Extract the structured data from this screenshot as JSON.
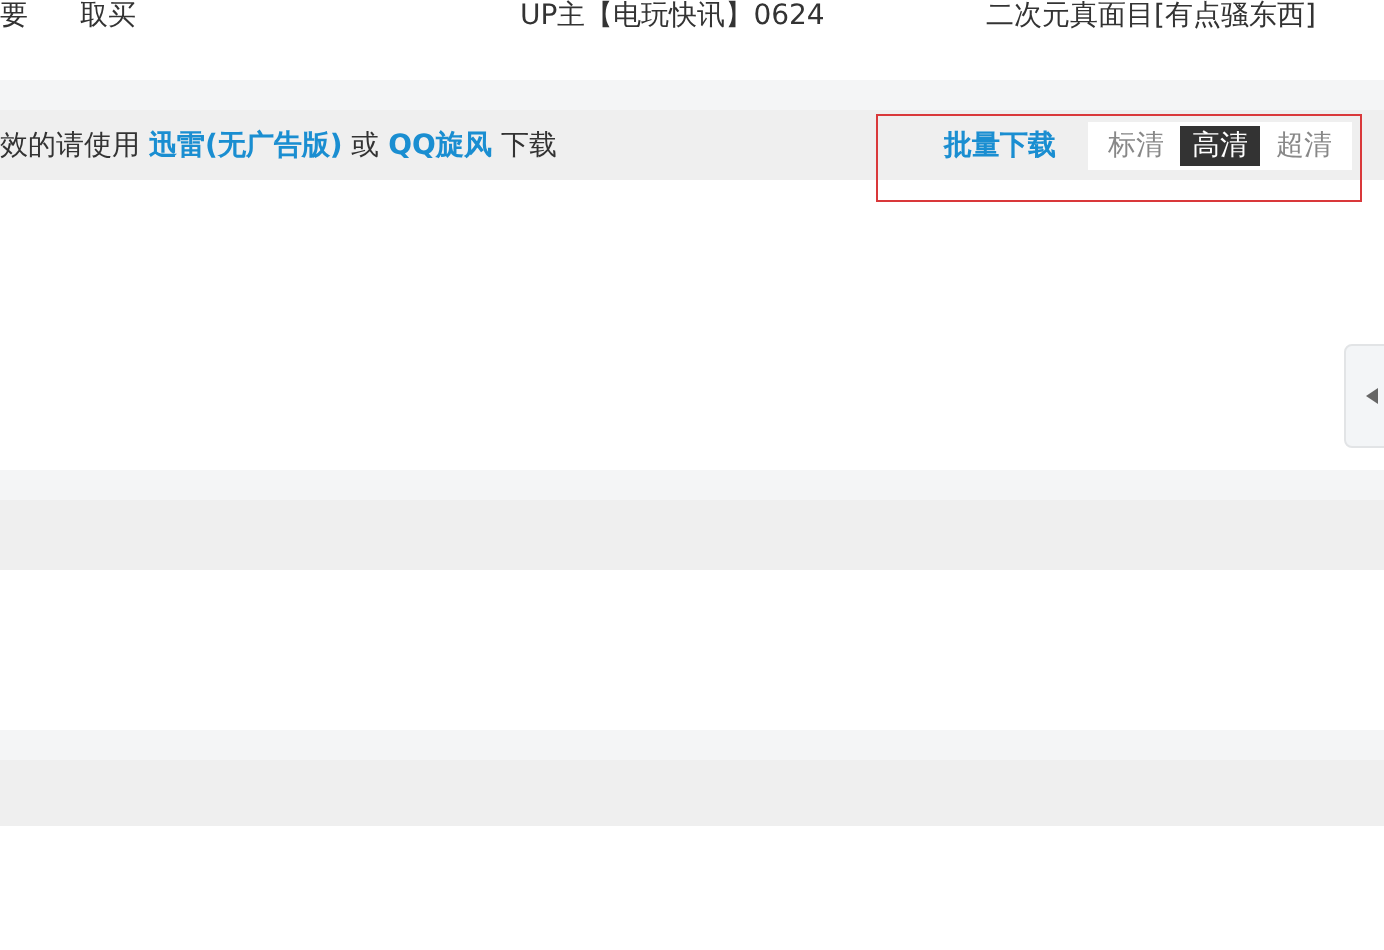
{
  "top_row": {
    "cells": [
      "要",
      "取买",
      "UP主【电玩快讯】0624",
      "二次元真面目[有点骚东西]"
    ]
  },
  "download_bar": {
    "notice": "效的请使用 **迅雷(无广告版)** 或 **QQ旋风** 下载",
    "batch_download": "批量下载",
    "quality_options": [
      {
        "label": "标清",
        "selected": false
      },
      {
        "label": "高清",
        "selected": true
      },
      {
        "label": "超清",
        "selected": false
      }
    ]
  }
}
